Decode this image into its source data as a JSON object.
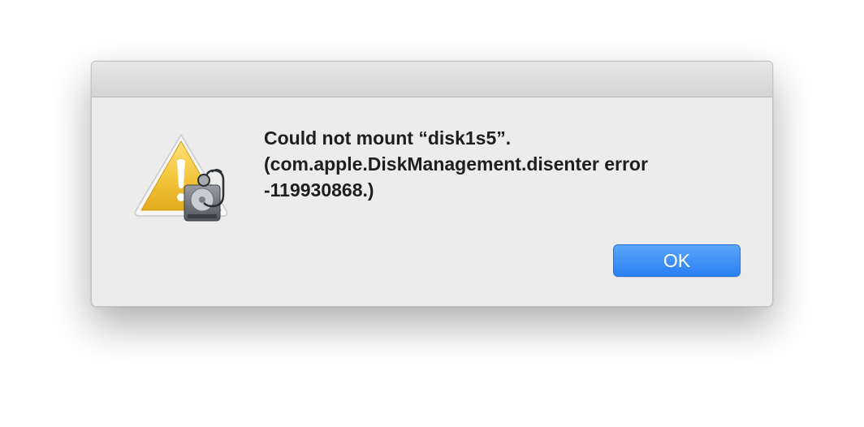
{
  "alert": {
    "message_lines": [
      "Could not mount “disk1s5”.",
      "(com.apple.DiskManagement.disenter error",
      "-119930868.)"
    ],
    "ok_label": "OK",
    "icon": "disk-utility-warning-icon"
  },
  "colors": {
    "dialog_background": "#ececec",
    "button_accent": "#2a7ff3",
    "warning_yellow": "#f2c23a"
  }
}
